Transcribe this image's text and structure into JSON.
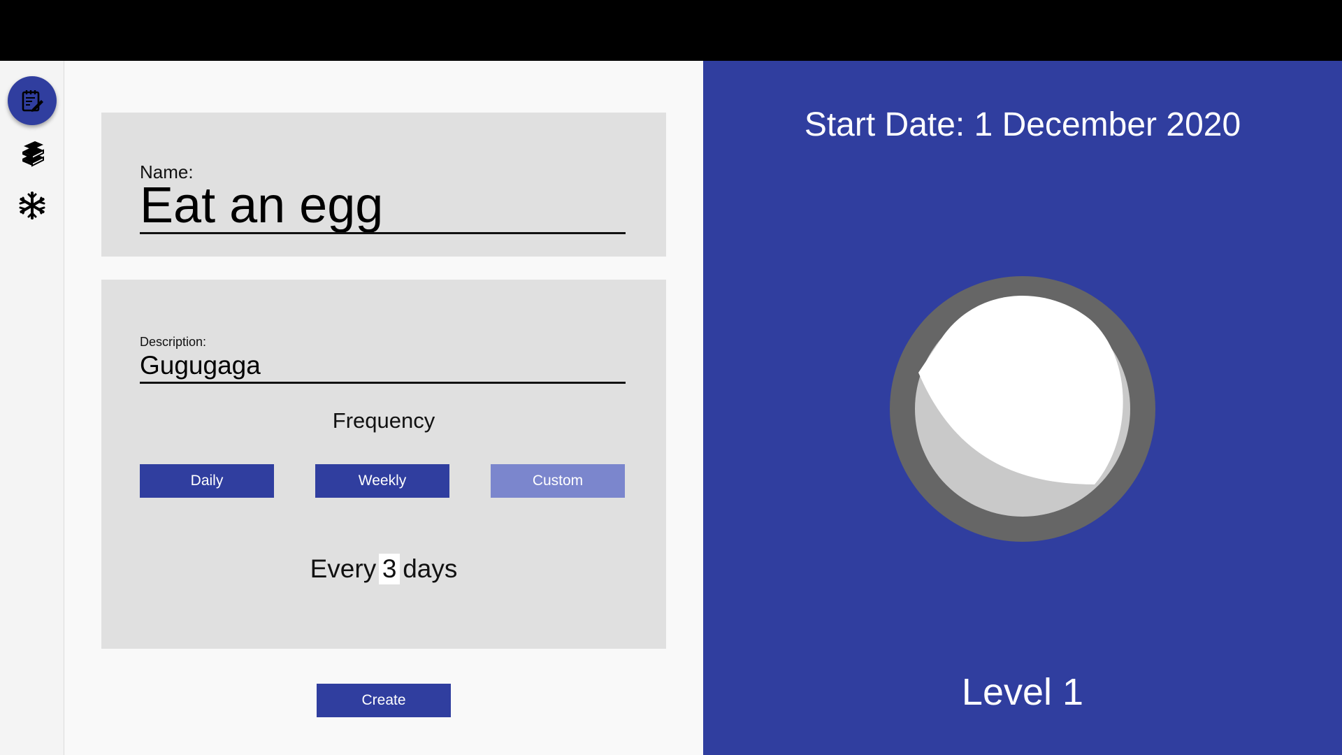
{
  "sidebar": {
    "items": [
      {
        "icon": "notepad-edit-icon",
        "active": true
      },
      {
        "icon": "books-icon",
        "active": false
      },
      {
        "icon": "snowflake-icon",
        "active": false
      }
    ]
  },
  "form": {
    "name_label": "Name:",
    "name_value": "Eat an egg",
    "description_label": "Description:",
    "description_value": "Gugugaga",
    "frequency_title": "Frequency",
    "frequency_options": [
      "Daily",
      "Weekly",
      "Custom"
    ],
    "frequency_selected": "Custom",
    "every_prefix": "Every",
    "every_value": "3",
    "every_suffix": "days",
    "create_label": "Create"
  },
  "preview": {
    "start_date": "Start Date: 1 December 2020",
    "level": "Level 1"
  },
  "colors": {
    "accent": "#303e9f",
    "selected": "#7b86cd",
    "card": "#e0e0e0"
  }
}
